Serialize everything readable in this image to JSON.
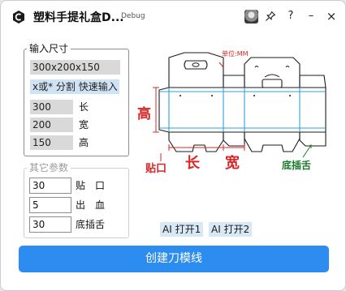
{
  "titlebar": {
    "title": "塑料手提礼盒D...",
    "debug_tag": "Debug",
    "help": "?",
    "minimize": "–",
    "close": "×"
  },
  "input_group": {
    "legend": "输入尺寸",
    "size_value": "300x200x150",
    "hint": "x或* 分割 快速输入",
    "length": {
      "value": "300",
      "label": "长"
    },
    "width": {
      "value": "200",
      "label": "宽"
    },
    "height": {
      "value": "150",
      "label": "高"
    }
  },
  "other_group": {
    "legend": "其它参数",
    "glue_flap": {
      "value": "30",
      "label": "贴　口"
    },
    "bleed": {
      "value": "5",
      "label": "出　血"
    },
    "bottom_tuck": {
      "value": "30",
      "label": "底插舌"
    }
  },
  "ai_buttons": [
    "AI 打开1",
    "AI 打开2"
  ],
  "primary_button": "创建刀模线",
  "diagram": {
    "unit": "单位:MM",
    "height_label": "高",
    "length_label": "长",
    "width_label": "宽",
    "glue_label": "贴口",
    "bottom_label": "底插舌",
    "colors": {
      "dimension": "#d62828",
      "crease": "#2aa3d8",
      "bottom": "#1a7a2a"
    }
  }
}
